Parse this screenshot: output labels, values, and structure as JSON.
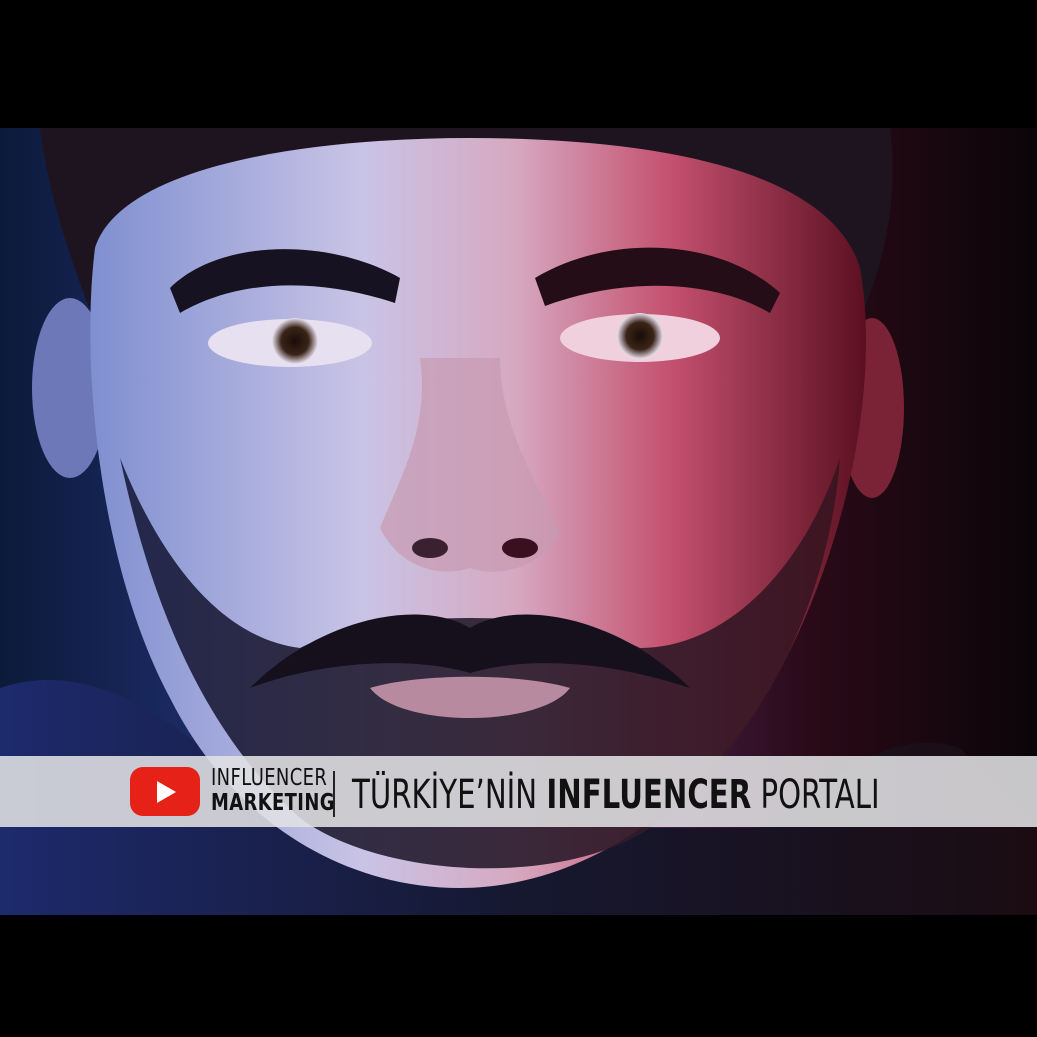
{
  "photo": {
    "description_icon": "portrait-photo",
    "colors": {
      "left_light": "#3a4fa8",
      "right_light": "#e0355a",
      "background": "#000000"
    }
  },
  "banner": {
    "logo_icon": "youtube-play-icon",
    "logo_color": "#e62117",
    "brand_line1": "INFLUENCER",
    "brand_line2": "MARKETING",
    "tagline_part1": "TÜRKİYE’NİN ",
    "tagline_bold": "INFLUENCER",
    "tagline_part2": " PORTALI"
  }
}
